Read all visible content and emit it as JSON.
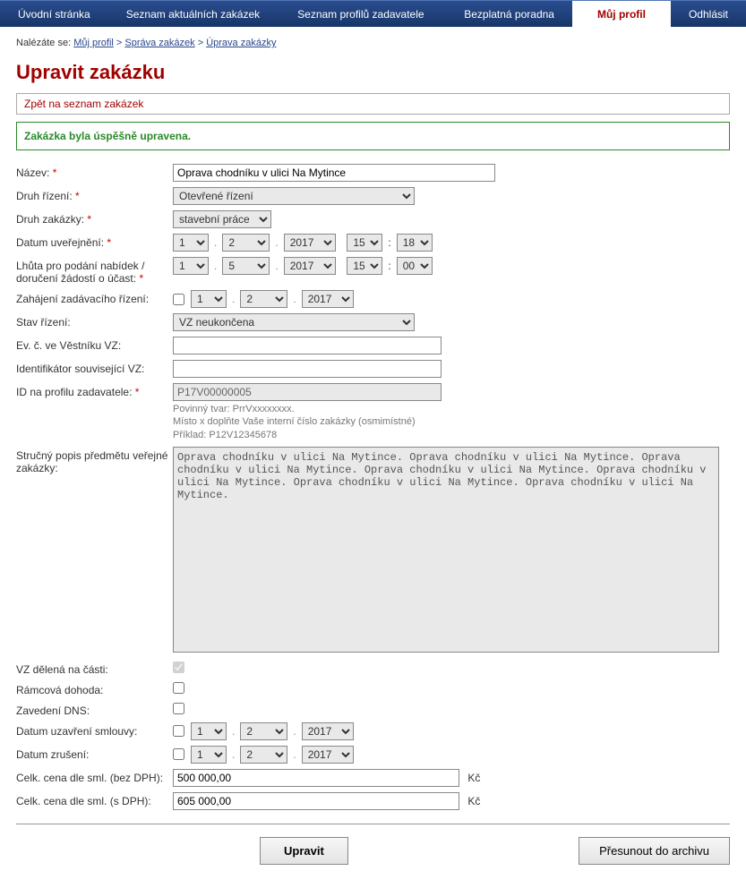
{
  "nav": {
    "items": [
      "Úvodní stránka",
      "Seznam aktuálních zakázek",
      "Seznam profilů zadavatele",
      "Bezplatná poradna",
      "Můj profil",
      "Odhlásit"
    ],
    "active_index": 4
  },
  "breadcrumb": {
    "prefix": "Nalézáte se:",
    "items": [
      "Můj profil",
      "Správa zakázek",
      "Úprava zakázky"
    ]
  },
  "page_title": "Upravit zakázku",
  "backlink": "Zpět na seznam zakázek",
  "success_msg": "Zakázka byla úspěšně upravena.",
  "labels": {
    "nazev": "Název:",
    "druh_rizeni": "Druh řízení:",
    "druh_zakazky": "Druh zakázky:",
    "datum_uverejneni": "Datum uveřejnění:",
    "lhuta": "Lhůta pro podání nabídek / doručení žádostí o účast:",
    "zahajeni": "Zahájení zadávacího řízení:",
    "stav": "Stav řízení:",
    "ev_c": "Ev. č. ve Věstníku VZ:",
    "identifikator": "Identifikátor související VZ:",
    "id_profil": "ID na profilu zadavatele:",
    "popis": "Stručný popis předmětu veřejné zakázky:",
    "vz_delena": "VZ dělená na části:",
    "ramcova": "Rámcová dohoda:",
    "zavedeni_dns": "Zavedení DNS:",
    "datum_smlouvy": "Datum uzavření smlouvy:",
    "datum_zruseni": "Datum zrušení:",
    "cena_bez": "Celk. cena dle sml. (bez DPH):",
    "cena_s": "Celk. cena dle sml. (s DPH):"
  },
  "values": {
    "nazev": "Oprava chodníku v ulici Na Mytince",
    "druh_rizeni": "Otevřené řízení",
    "druh_zakazky": "stavební práce",
    "datum_uverejneni": {
      "d": "1",
      "m": "2",
      "y": "2017",
      "h": "15",
      "min": "18"
    },
    "lhuta": {
      "d": "1",
      "m": "5",
      "y": "2017",
      "h": "15",
      "min": "00"
    },
    "zahajeni": {
      "d": "1",
      "m": "2",
      "y": "2017"
    },
    "stav": "VZ neukončena",
    "ev_c": "",
    "identifikator": "",
    "id_profil": "P17V00000005",
    "id_profil_help1": "Povinný tvar: PrrVxxxxxxxx.",
    "id_profil_help2": "Místo x doplňte Vaše interní číslo zakázky (osmimístné)",
    "id_profil_help3": "Příklad: P12V12345678",
    "popis": "Oprava chodníku v ulici Na Mytince. Oprava chodníku v ulici Na Mytince. Oprava chodníku v ulici Na Mytince. Oprava chodníku v ulici Na Mytince. Oprava chodníku v ulici Na Mytince. Oprava chodníku v ulici Na Mytince. Oprava chodníku v ulici Na Mytince.",
    "vz_delena": true,
    "ramcova": false,
    "zavedeni_dns": false,
    "datum_smlouvy_enabled": false,
    "datum_smlouvy": {
      "d": "1",
      "m": "2",
      "y": "2017"
    },
    "datum_zruseni_enabled": false,
    "datum_zruseni": {
      "d": "1",
      "m": "2",
      "y": "2017"
    },
    "cena_bez": "500 000,00",
    "cena_s": "605 000,00",
    "currency": "Kč"
  },
  "buttons": {
    "submit": "Upravit",
    "archive": "Přesunout do archivu"
  }
}
